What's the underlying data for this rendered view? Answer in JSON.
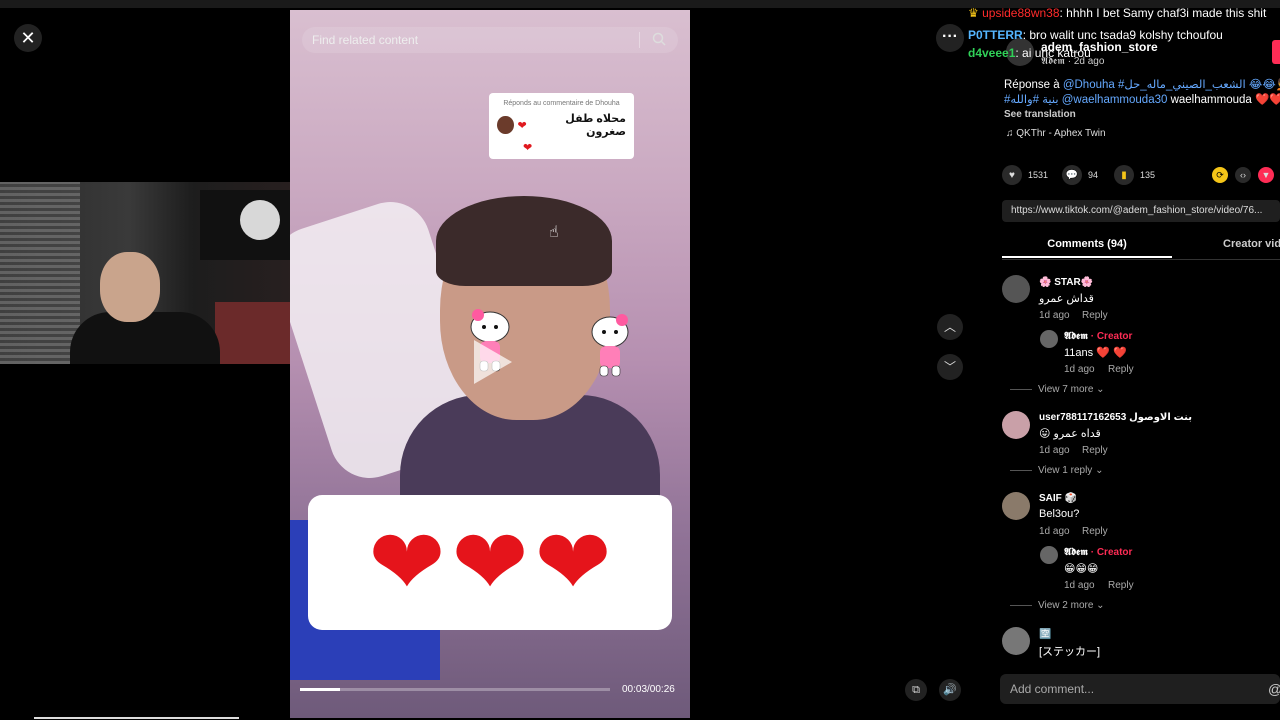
{
  "top": {
    "close_icon": "close-icon"
  },
  "search": {
    "placeholder": "Find related content",
    "icon": "search-icon"
  },
  "video": {
    "reply_card_title": "Réponds au commentaire de Dhouha",
    "reply_card_text": "محلاه طفل صغرون",
    "time": "00:03/00:26",
    "progress": 0.13
  },
  "chat": {
    "lines": [
      {
        "user": "upside88wn38",
        "text": ": hhhh I bet Samy chaf3i made this shit"
      },
      {
        "user": "P0TTERR",
        "text": ": bro walit unc tsada9 kolshy tchoufou"
      },
      {
        "user": "d4veee1",
        "text": ": ai unc katrou"
      }
    ]
  },
  "post": {
    "author": "adem_fashion_store",
    "author_sub": "𝕬𝖉𝖊𝖒 · 2d ago",
    "desc_line1_prefix": "Réponse à ",
    "desc_line1_tags": "@Dhouha #الشعب_الصيني_ماله_حل 😂😂🤦 #v",
    "desc_line2_tags": "#بنية #والله @waelhammouda30",
    "desc_line2_text": " waelhammouda ❤️❤️",
    "see_translation": "See translation",
    "music": "♫  QKThr - Aphex Twin",
    "likes": "1531",
    "comments": "94",
    "saves": "135",
    "url": "https://www.tiktok.com/@adem_fashion_store/video/76..."
  },
  "tabs": {
    "comments": "Comments (94)",
    "creator": "Creator videos"
  },
  "comments": [
    {
      "name": "🌸 STAR🌸",
      "text": "قداش عمرو",
      "meta": "1d ago",
      "reply": "Reply",
      "sub": {
        "name": "𝕬𝖉𝖊𝖒",
        "creator": " · Creator",
        "text": "11ans ❤️ ❤️",
        "meta": "1d ago",
        "reply": "Reply"
      },
      "view_more": "View 7 more ⌄"
    },
    {
      "name": "user788117162653 بنت الاوصول",
      "text": "😛 قداه عمرو",
      "meta": "1d ago",
      "reply": "Reply",
      "view_more": "View 1 reply ⌄"
    },
    {
      "name": "SAIF 🎲",
      "text": "Bel3ou?",
      "meta": "1d ago",
      "reply": "Reply",
      "sub": {
        "name": "𝕬𝖉𝖊𝖒",
        "creator": " · Creator",
        "text": "😁😁😁",
        "meta": "1d ago",
        "reply": "Reply"
      },
      "view_more": "View 2 more ⌄"
    },
    {
      "name": "🈳",
      "text": "[ステッカー]"
    }
  ],
  "add_comment": {
    "placeholder": "Add comment..."
  },
  "colors": {
    "accent": "#fe2c55",
    "link": "#65a9ff",
    "heart": "#e5141b"
  }
}
